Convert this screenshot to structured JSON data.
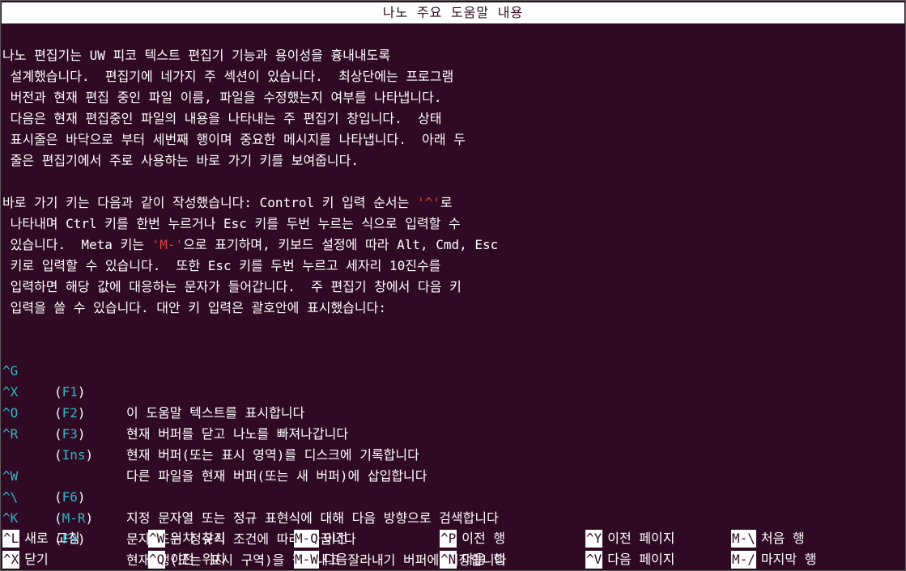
{
  "title": "나노 주요 도움말 내용",
  "para1": [
    "나노 편집기는 UW 피코 텍스트 편집기 기능과 용이성을 흉내내도록",
    " 설계했습니다.  편집기에 네가지 주 섹션이 있습니다.  최상단에는 프로그램",
    " 버전과 현재 편집 중인 파일 이름, 파일을 수정했는지 여부를 나타냅니다.",
    " 다음은 현재 편집중인 파일의 내용을 나타내는 주 편집기 창입니다.  상태",
    " 표시줄은 바닥으로 부터 세번째 행이며 중요한 메시지를 나타냅니다.  아래 두",
    " 줄은 편집기에서 주로 사용하는 바로 가기 키를 보여줍니다."
  ],
  "para2": {
    "l1_a": "바로 가기 키는 다음과 같이 작성했습니다: Control 키 입력 순서는 ",
    "l1_hl": "'^'",
    "l1_b": "로",
    "l2": " 나타내며 Ctrl 키를 한번 누르거나 Esc 키를 두번 누르는 식으로 입력할 수",
    "l3_a": " 있습니다.  Meta 키는 ",
    "l3_hl": "'M-'",
    "l3_b": "으로 표기하며, 키보드 설정에 따라 Alt, Cmd, Esc",
    "l4": " 키로 입력할 수 있습니다.  또한 Esc 키를 두번 누르고 세자리 10진수를",
    "l5": " 입력하면 해당 값에 대응하는 문자가 들어갑니다.  주 편집기 창에서 다음 키",
    "l6": " 입력을 쓸 수 있습니다. 대안 키 입력은 괄호안에 표시했습니다:"
  },
  "commands": [
    {
      "key": "^G",
      "alt": "F1",
      "desc": "이 도움말 텍스트를 표시합니다"
    },
    {
      "key": "^X",
      "alt": "F2",
      "desc": "현재 버퍼를 닫고 나노를 빠져나갑니다"
    },
    {
      "key": "^O",
      "alt": "F3",
      "desc": "현재 버퍼(또는 표시 영역)를 디스크에 기록합니다"
    },
    {
      "key": "^R",
      "alt": "Ins",
      "desc": "다른 파일을 현재 버퍼(또는 새 버퍼)에 삽입합니다"
    },
    {
      "key": "^W",
      "alt": "F6",
      "desc": "지정 문자열 또는 정규 표현식에 대해 다음 방향으로 검색합니다"
    },
    {
      "key": "^\\",
      "alt": "M-R",
      "desc": "문자 또는 정규식 조건에 따라 바꿉니다"
    },
    {
      "key": "^K",
      "alt": "F9",
      "desc": "현재 행(또는 표시 구역)을 잘라내고 잘라내기 버퍼에 저장합니다"
    }
  ],
  "shortcuts": [
    {
      "key": "^L",
      "label": "새로 고침"
    },
    {
      "key": "^W",
      "label": "위치 찾기"
    },
    {
      "key": "M-Q",
      "label": "이전"
    },
    {
      "key": "^P",
      "label": "이전 행"
    },
    {
      "key": "^Y",
      "label": "이전 페이지"
    },
    {
      "key": "M-\\",
      "label": "처음 행"
    },
    {
      "key": "^X",
      "label": "닫기"
    },
    {
      "key": "^Q",
      "label": "이전 위치"
    },
    {
      "key": "M-W",
      "label": "다음"
    },
    {
      "key": "^N",
      "label": "다음 행"
    },
    {
      "key": "^V",
      "label": "다음 페이지"
    },
    {
      "key": "M-/",
      "label": "마지막 행"
    }
  ],
  "colors": {
    "background": "#300a24",
    "highlight": "#e0413a",
    "key": "#2fb9c4"
  }
}
